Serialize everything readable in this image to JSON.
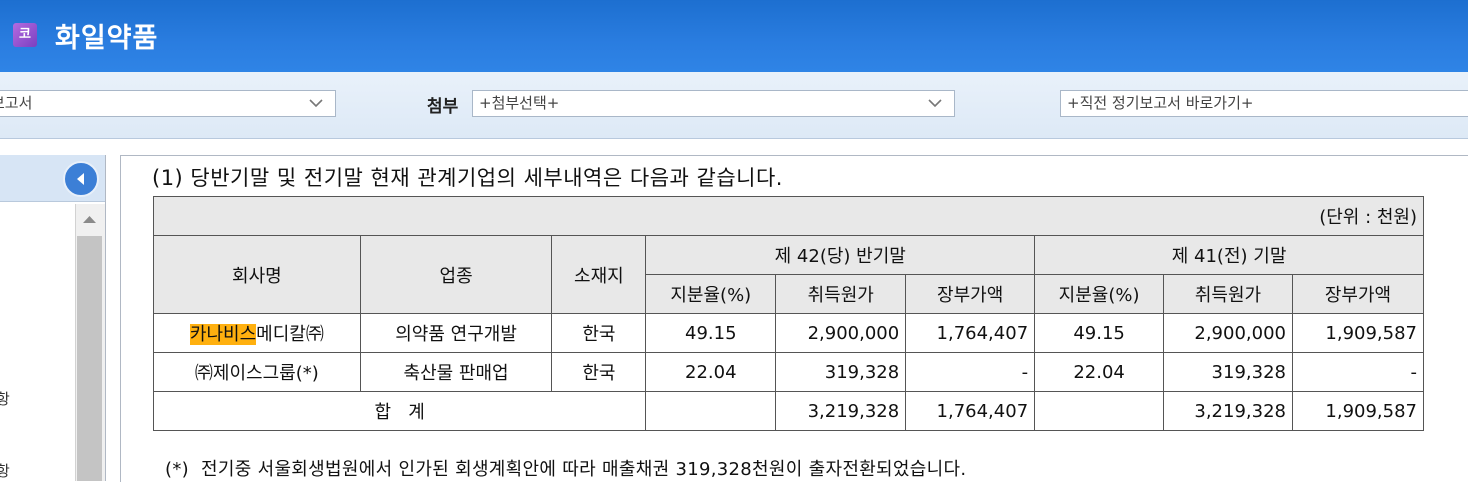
{
  "header": {
    "badge": "코",
    "company_name": "화일약품"
  },
  "toolbar": {
    "report_select_value": "보고서",
    "attachment_label": "첨부",
    "attachment_select_placeholder": "+첨부선택+",
    "quick_select_placeholder": "+직전 정기보고서 바로가기+"
  },
  "left_panel": {
    "fragment_1": "항",
    "fragment_2": "항"
  },
  "content": {
    "title": "(1) 당반기말 및 전기말 현재 관계기업의 세부내역은 다음과 같습니다.",
    "unit_note": "(단위 : 천원)",
    "columns": {
      "company": "회사명",
      "industry": "업종",
      "location": "소재지",
      "current_period": "제 42(당) 반기말",
      "prior_period": "제 41(전) 기말",
      "share_ratio": "지분율(%)",
      "acquisition_cost": "취득원가",
      "book_value": "장부가액"
    },
    "rows": [
      {
        "company_highlight": "카나비스",
        "company_rest": "메디칼㈜",
        "industry": "의약품 연구개발",
        "location": "한국",
        "cur_share": "49.15",
        "cur_cost": "2,900,000",
        "cur_book": "1,764,407",
        "prev_share": "49.15",
        "prev_cost": "2,900,000",
        "prev_book": "1,909,587"
      },
      {
        "company": "㈜제이스그룹(*)",
        "industry": "축산물 판매업",
        "location": "한국",
        "cur_share": "22.04",
        "cur_cost": "319,328",
        "cur_book": "-",
        "prev_share": "22.04",
        "prev_cost": "319,328",
        "prev_book": "-"
      }
    ],
    "total": {
      "label": "합   계",
      "cur_cost": "3,219,328",
      "cur_book": "1,764,407",
      "prev_cost": "3,219,328",
      "prev_book": "1,909,587"
    },
    "footnote": "(*)  전기중 서울회생법원에서 인가된 회생계획안에 따라 매출채권 319,328천원이 출자전환되었습니다."
  },
  "colors": {
    "header_blue": "#2a7de0",
    "highlight": "#ffb00f",
    "table_header_grey": "#e8e8e8"
  },
  "icons": [
    "corp-badge-icon",
    "chevron-down-icon",
    "collapse-left-icon",
    "scroll-up-icon"
  ]
}
